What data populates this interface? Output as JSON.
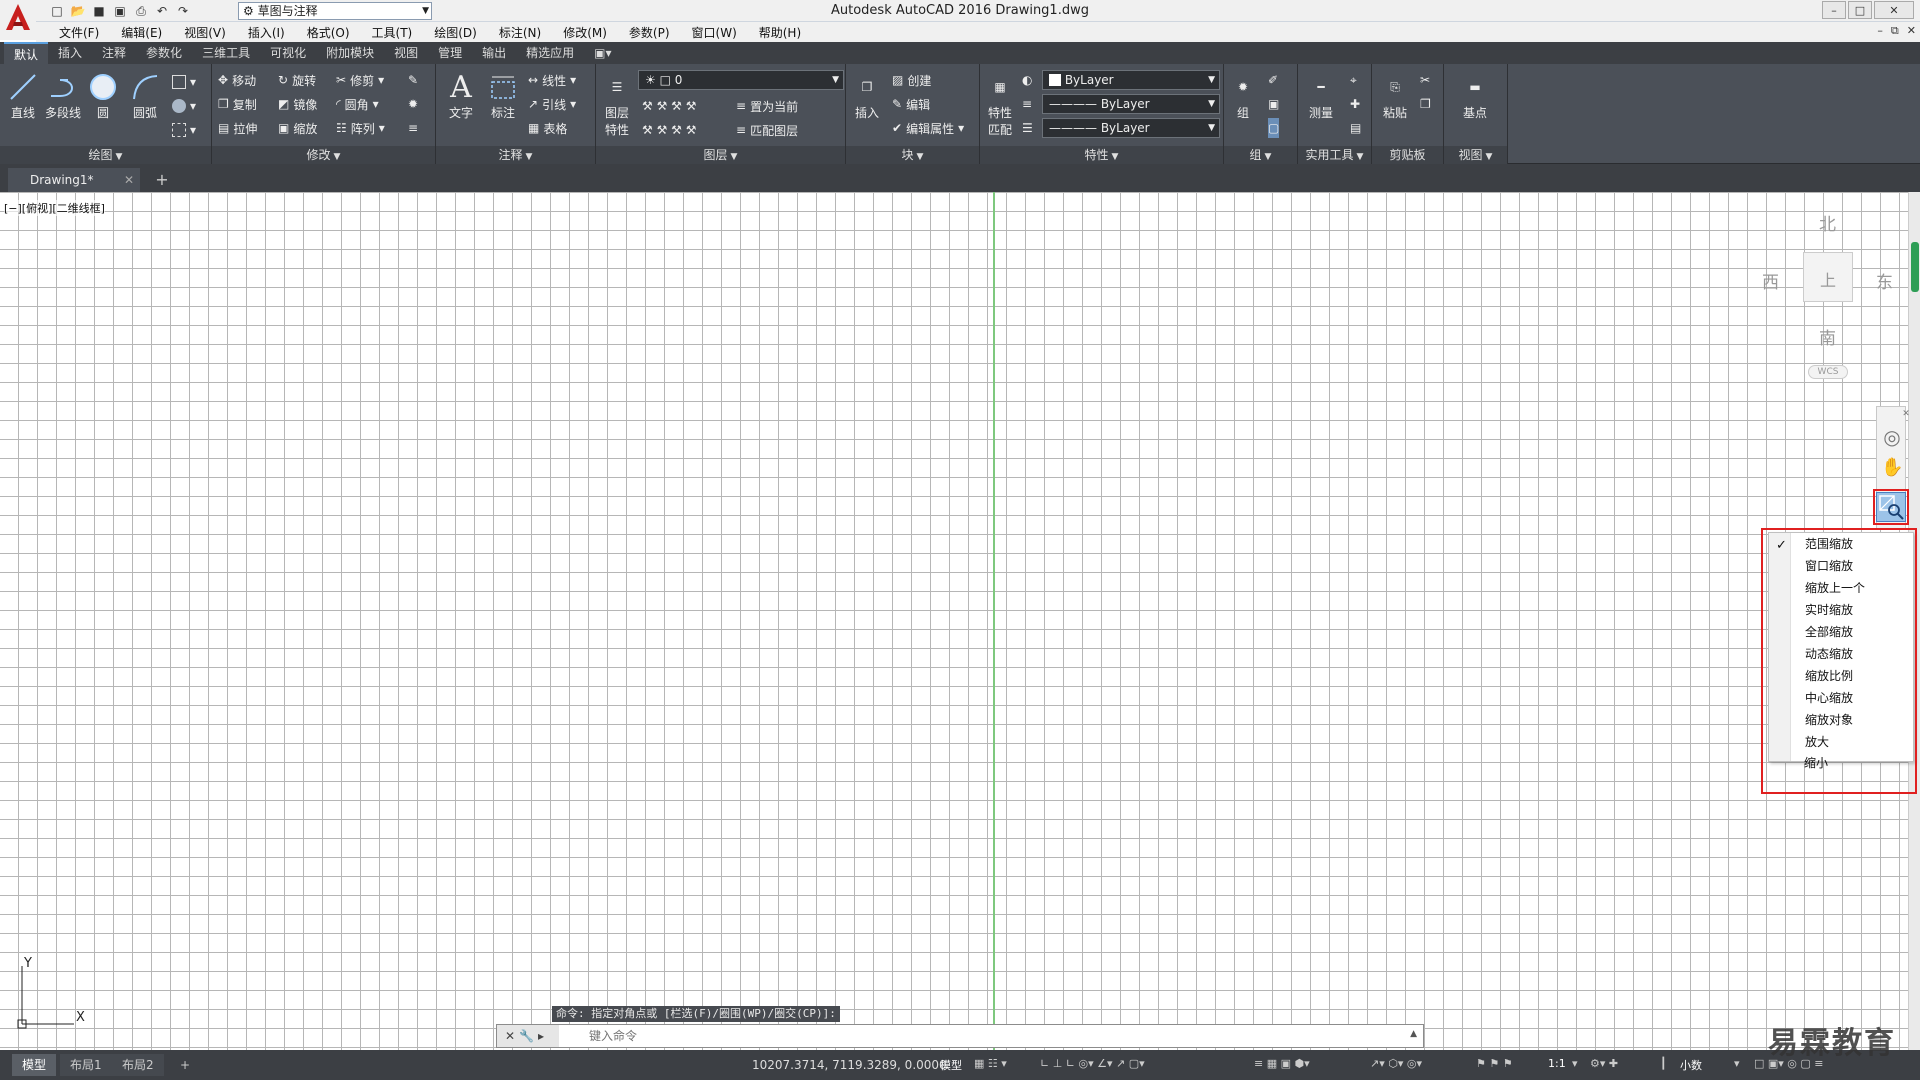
{
  "titlebar": {
    "app_title": "Autodesk AutoCAD 2016    Drawing1.dwg",
    "workspace": "草图与注释"
  },
  "menubar": [
    "文件(F)",
    "编辑(E)",
    "视图(V)",
    "插入(I)",
    "格式(O)",
    "工具(T)",
    "绘图(D)",
    "标注(N)",
    "修改(M)",
    "参数(P)",
    "窗口(W)",
    "帮助(H)"
  ],
  "ribbon_tabs": [
    "默认",
    "插入",
    "注释",
    "参数化",
    "三维工具",
    "可视化",
    "附加模块",
    "视图",
    "管理",
    "输出",
    "精选应用"
  ],
  "panels": {
    "draw": {
      "title": "绘图",
      "line": "直线",
      "polyline": "多段线",
      "circle": "圆",
      "arc": "圆弧"
    },
    "modify": {
      "title": "修改",
      "move": "移动",
      "rotate": "旋转",
      "trim": "修剪",
      "copy": "复制",
      "mirror": "镜像",
      "fillet": "圆角",
      "stretch": "拉伸",
      "scale": "缩放",
      "array": "阵列"
    },
    "annotation": {
      "title": "注释",
      "text": "文字",
      "dimension": "标注",
      "linear": "线性",
      "leader": "引线",
      "table": "表格"
    },
    "layers": {
      "title": "图层",
      "properties_1": "图层",
      "properties_2": "特性",
      "layer_name": "0",
      "set_current": "置为当前",
      "match_layer": "匹配图层"
    },
    "block": {
      "title": "块",
      "insert": "插入",
      "create": "创建",
      "edit": "编辑",
      "edit_attr": "编辑属性"
    },
    "properties": {
      "title": "特性",
      "match_1": "特性",
      "match_2": "匹配",
      "color": "ByLayer",
      "linetype": "ByLayer",
      "lineweight": "ByLayer"
    },
    "groups": {
      "title": "组",
      "group": "组"
    },
    "utilities": {
      "title": "实用工具",
      "measure": "测量"
    },
    "clipboard": {
      "title": "剪贴板",
      "paste": "粘贴"
    },
    "view": {
      "title": "视图",
      "base": "基点"
    }
  },
  "file_tab": {
    "name": "Drawing1*",
    "new": "+"
  },
  "viewport": {
    "controls": "[−][俯视][二维线框]"
  },
  "viewcube": {
    "north": "北",
    "south": "南",
    "east": "东",
    "west": "西",
    "top_face": "上",
    "wcs": "WCS"
  },
  "zoom_menu": {
    "items": [
      "范围缩放",
      "窗口缩放",
      "缩放上一个",
      "实时缩放",
      "全部缩放",
      "动态缩放",
      "缩放比例",
      "中心缩放",
      "缩放对象",
      "放大",
      "缩小"
    ],
    "checked": 0
  },
  "ucs": {
    "x": "X",
    "y": "Y"
  },
  "command": {
    "history": "命令: 指定对角点或 [栏选(F)/圈围(WP)/圈交(CP)]:",
    "placeholder": "键入命令"
  },
  "statusbar": {
    "layouts": [
      "模型",
      "布局1",
      "布局2"
    ],
    "add": "+",
    "coords": "10207.3714, 7119.3289, 0.0000",
    "mode": "模型",
    "scale": "1:1",
    "units": "小数"
  },
  "watermark": "易霖教育"
}
